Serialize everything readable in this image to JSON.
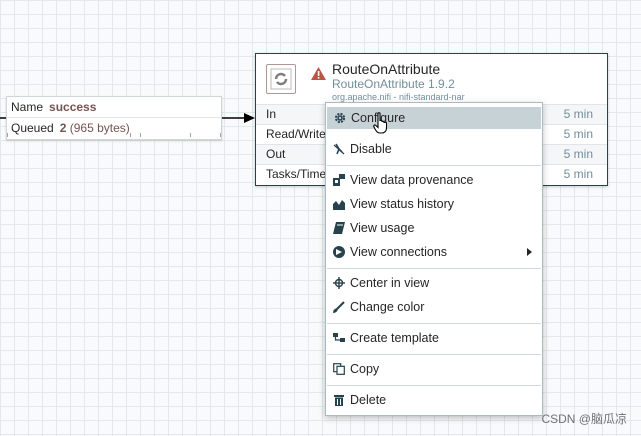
{
  "connection": {
    "name_label": "Name",
    "name_value": "success",
    "queued_label": "Queued",
    "queued_count": "2",
    "queued_bytes": "(965 bytes)"
  },
  "processor": {
    "name": "RouteOnAttribute",
    "type": "RouteOnAttribute 1.9.2",
    "bundle": "org.apache.nifi - nifi-standard-nar",
    "warning_icon": "warning-triangle-icon",
    "stats": [
      {
        "label": "In",
        "time": "5 min"
      },
      {
        "label": "Read/Write",
        "time": "5 min"
      },
      {
        "label": "Out",
        "time": "5 min"
      },
      {
        "label": "Tasks/Time",
        "time": "5 min"
      }
    ]
  },
  "context_menu": {
    "items": [
      {
        "label": "Configure",
        "icon": "gear-icon"
      },
      {
        "label": "Disable",
        "icon": "disable-icon"
      },
      {
        "label": "View data provenance",
        "icon": "provenance-icon"
      },
      {
        "label": "View status history",
        "icon": "area-chart-icon"
      },
      {
        "label": "View usage",
        "icon": "book-icon"
      },
      {
        "label": "View connections",
        "icon": "connections-icon"
      },
      {
        "label": "Center in view",
        "icon": "crosshair-icon"
      },
      {
        "label": "Change color",
        "icon": "paintbrush-icon"
      },
      {
        "label": "Create template",
        "icon": "template-icon"
      },
      {
        "label": "Copy",
        "icon": "copy-icon"
      },
      {
        "label": "Delete",
        "icon": "trash-icon"
      }
    ]
  },
  "watermark": "CSDN @脑瓜凉",
  "colors": {
    "processor_border": "#26424d",
    "menu_highlight": "#c7d2d7",
    "connection_value": "#775351",
    "secondary_text": "#728e9b"
  }
}
